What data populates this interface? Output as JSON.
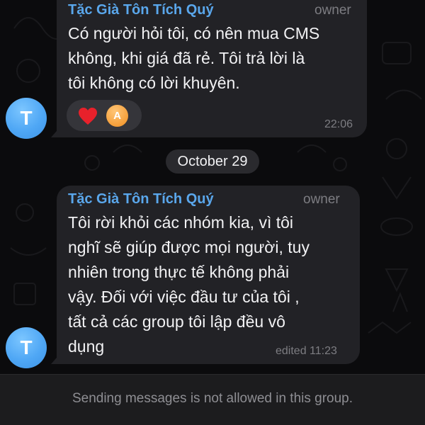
{
  "messages": [
    {
      "avatar_letter": "T",
      "sender": "Tặc Già Tôn Tích Quý",
      "role": "owner",
      "text": "Có người hỏi tôi, có nên mua CMS\nkhông, khi giá đã rẻ. Tôi trả lời là\ntôi không có lời khuyên.",
      "time": "22:06",
      "reactions": [
        {
          "icon": "heart-icon",
          "color": "#e8212b"
        },
        {
          "avatar_letter": "A",
          "color": "#f59f3a"
        }
      ]
    },
    {
      "avatar_letter": "T",
      "sender": "Tặc Già Tôn Tích Quý",
      "role": "owner",
      "text": "Tôi rời khỏi các nhóm kia, vì tôi\nnghĩ sẽ giúp được mọi người, tuy\nnhiên trong thực tế không phải\nvậy. Đối với việc đầu tư của tôi ,\n tất cả các group tôi lập đều vô\ndụng",
      "time": "edited 11:23"
    }
  ],
  "date_separator": "October 29",
  "footer": {
    "notice": "Sending messages is not allowed in this group."
  },
  "colors": {
    "background": "#0b0b0d",
    "bubble": "#222226",
    "sender_name": "#5aa7ec",
    "avatar": "#4fa7f5",
    "meta_text": "#7d7d82"
  }
}
